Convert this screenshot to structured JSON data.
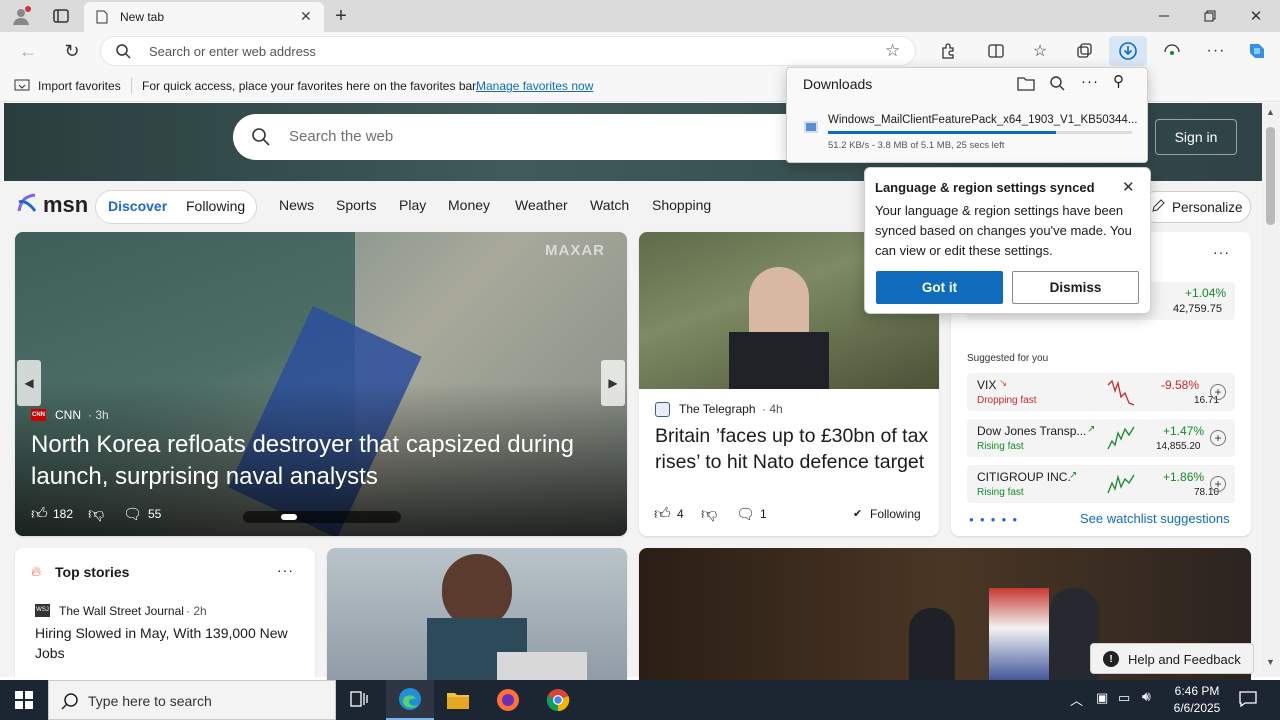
{
  "browser": {
    "tab_title": "New tab",
    "address_placeholder": "Search or enter web address",
    "favorites_bar": {
      "import_label": "Import favorites",
      "hint": "For quick access, place your favorites here on the favorites bar.",
      "manage_link": "Manage favorites now"
    }
  },
  "downloads": {
    "title": "Downloads",
    "file_name": "Windows_MailClientFeaturePack_x64_1903_V1_KB50344...",
    "progress": 0.75,
    "status": "51.2 KB/s - 3.8 MB of 5.1 MB, 25 secs left"
  },
  "sync_popup": {
    "title": "Language & region settings synced",
    "body": "Your language & region settings have been synced based on changes you've made. You can view or edit these settings.",
    "primary": "Got it",
    "secondary": "Dismiss"
  },
  "msn": {
    "search_placeholder": "Search the web",
    "sign_in": "Sign in",
    "logo_text": "msn",
    "feed_tabs": [
      "Discover",
      "Following"
    ],
    "nav": [
      "News",
      "Sports",
      "Play",
      "Money",
      "Weather",
      "Watch",
      "Shopping"
    ],
    "personalize": "Personalize"
  },
  "hero": {
    "watermark": "MAXAR",
    "source": "CNN",
    "age": "· 3h",
    "headline": "North Korea refloats destroyer that capsized during launch, surprising naval analysts",
    "likes": "182",
    "comments": "55"
  },
  "story2": {
    "source": "The Telegraph",
    "age": "· 4h",
    "headline": "Britain ’faces up to £30bn of tax rises’ to hit Nato defence target",
    "likes": "4",
    "comments": "1",
    "following": "Following"
  },
  "markets": {
    "top_change": "+1.04%",
    "top_value": "42,759.75",
    "suggested_label": "Suggested for you",
    "stocks": [
      {
        "name": "VIX",
        "sub": "Dropping fast",
        "change": "-9.58%",
        "value": "16.71"
      },
      {
        "name": "Dow Jones Transp...",
        "sub": "Rising fast",
        "change": "+1.47%",
        "value": "14,855.20"
      },
      {
        "name": "CITIGROUP INC.",
        "sub": "Rising fast",
        "change": "+1.86%",
        "value": "78.10"
      }
    ],
    "see_more": "See watchlist suggestions"
  },
  "top_stories": {
    "title": "Top stories",
    "source": "The Wall Street Journal",
    "age": "· 2h",
    "headline": "Hiring Slowed in May, With 139,000 New Jobs"
  },
  "feedback": "Help and Feedback",
  "taskbar": {
    "search_placeholder": "Type here to search",
    "time": "6:46 PM",
    "date": "6/6/2025"
  },
  "colors": {
    "accent": "#0f6cbd",
    "msn_blue": "#2266d6",
    "taskbar": "#1c2532"
  }
}
